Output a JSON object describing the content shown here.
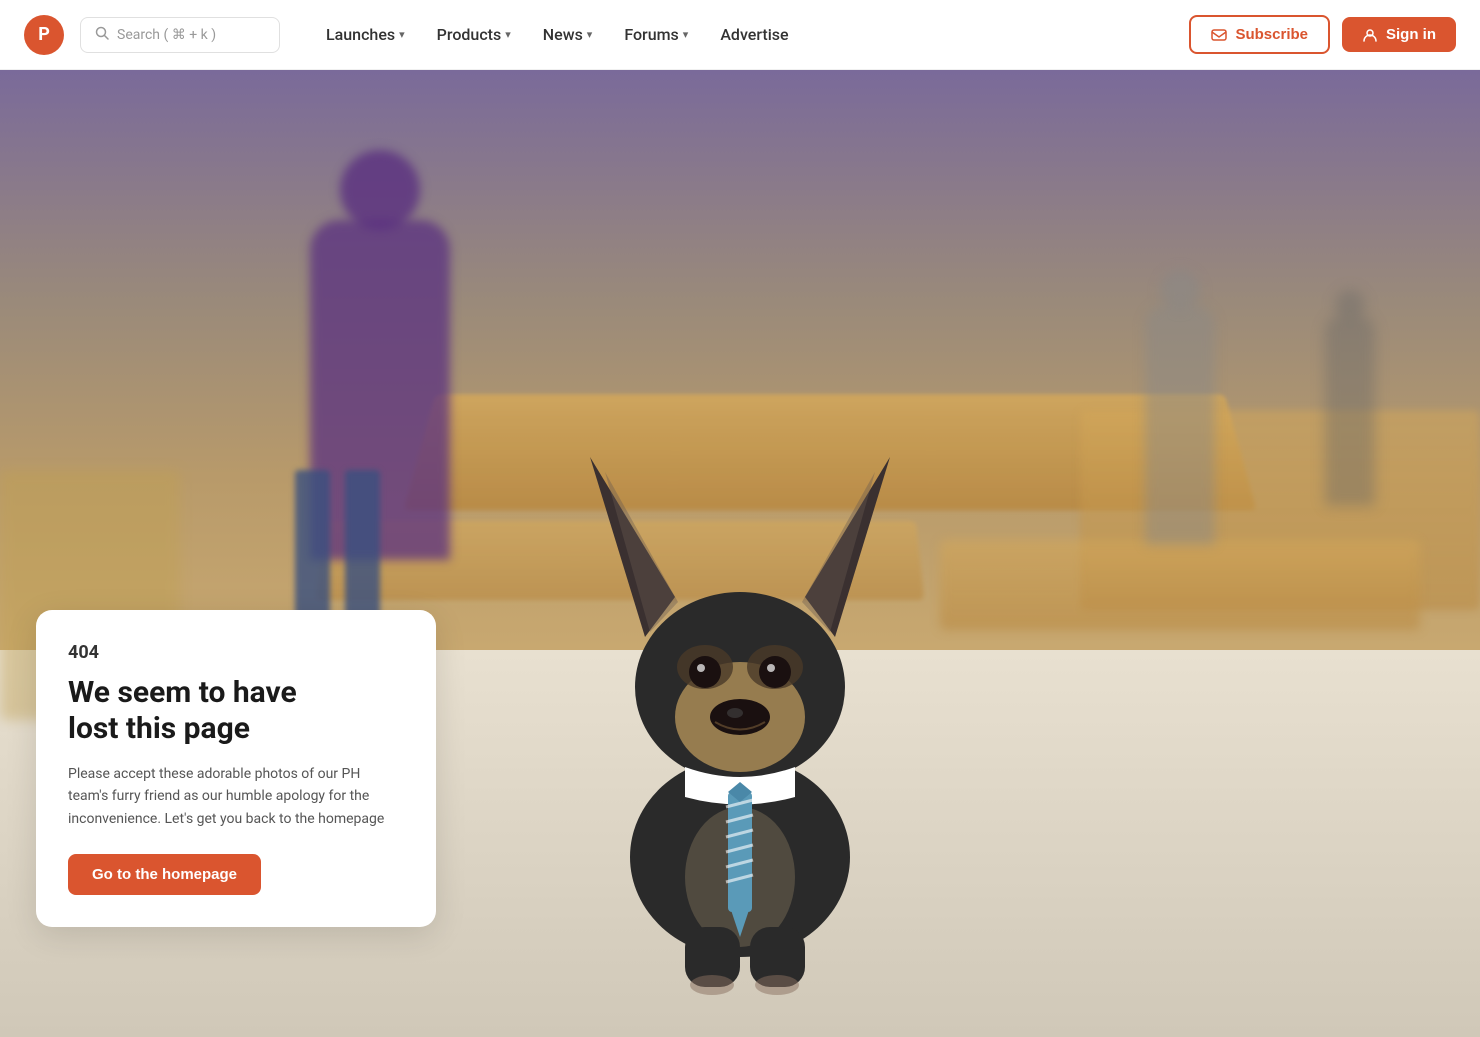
{
  "nav": {
    "logo_letter": "P",
    "search_placeholder": "Search ( ⌘ + k )",
    "links": [
      {
        "label": "Launches",
        "has_chevron": true
      },
      {
        "label": "Products",
        "has_chevron": true
      },
      {
        "label": "News",
        "has_chevron": true
      },
      {
        "label": "Forums",
        "has_chevron": true
      },
      {
        "label": "Advertise",
        "has_chevron": false
      }
    ],
    "subscribe_label": "Subscribe",
    "signin_label": "Sign in"
  },
  "error": {
    "code": "404",
    "title_line1": "We seem to have",
    "title_line2": "lost this page",
    "description": "Please accept these adorable photos of our PH team's furry friend as our humble apology for the inconvenience. Let's get you back to the homepage",
    "cta_label": "Go to the homepage"
  },
  "colors": {
    "brand": "#da552f",
    "text_dark": "#1a1a1a",
    "text_muted": "#555555"
  }
}
